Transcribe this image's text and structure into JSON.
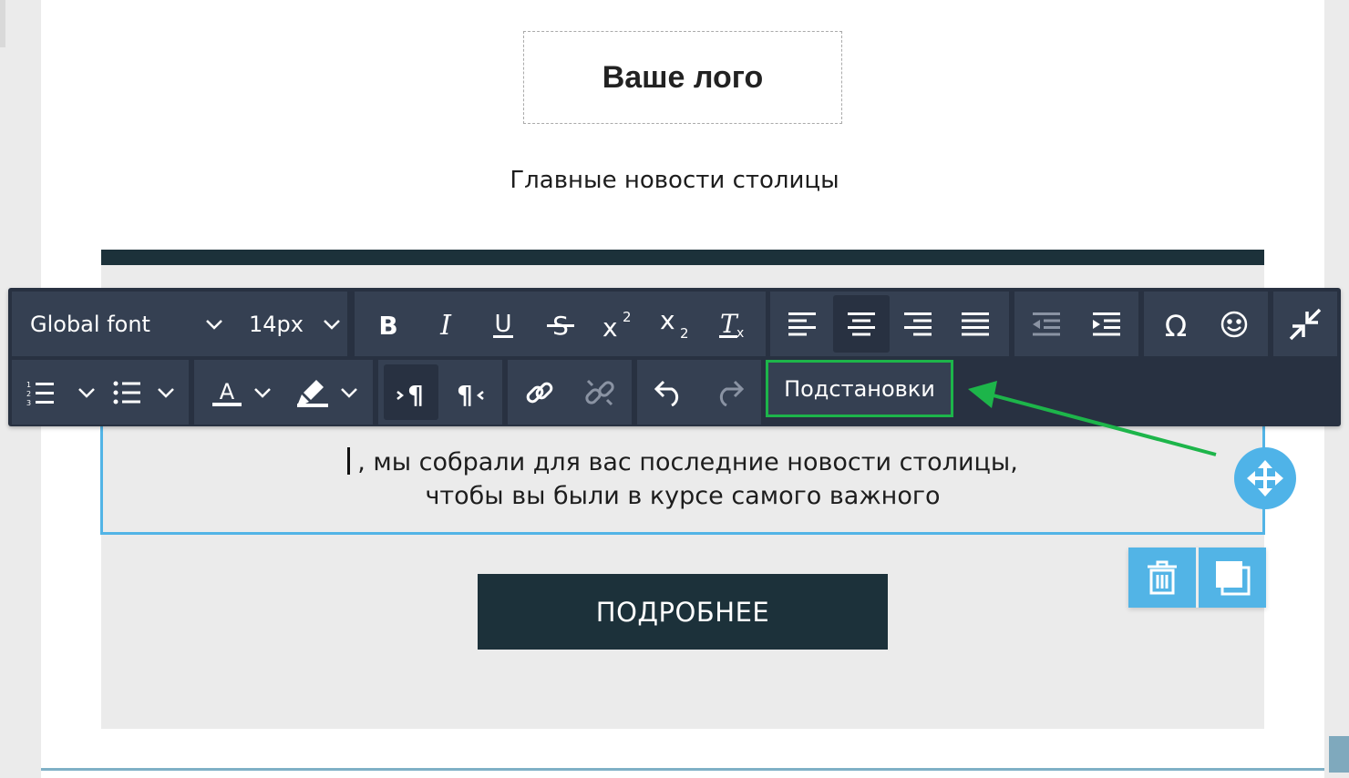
{
  "email": {
    "logo_text": "Ваше лого",
    "headline": "Главные новости столицы",
    "body_line1": ", мы собрали для вас последние новости столицы,",
    "body_line2": "чтобы вы были в курсе самого важного",
    "button_label": "ПОДРОБНЕЕ"
  },
  "toolbar": {
    "font_family": "Global font",
    "font_size": "14px",
    "substitutions_label": "Подстановки",
    "icons": [
      "bold-icon",
      "italic-icon",
      "underline-icon",
      "strikethrough-icon",
      "superscript-icon",
      "subscript-icon",
      "clear-format-icon",
      "align-left-icon",
      "align-center-icon",
      "align-right-icon",
      "align-justify-icon",
      "outdent-icon",
      "indent-icon",
      "special-char-icon",
      "emoji-icon",
      "collapse-icon",
      "ordered-list-icon",
      "unordered-list-icon",
      "text-color-icon",
      "highlight-icon",
      "ltr-icon",
      "rtl-icon",
      "link-icon",
      "unlink-icon",
      "undo-icon",
      "redo-icon"
    ]
  },
  "block_controls": {
    "icons": [
      "move-icon",
      "trash-icon",
      "duplicate-icon"
    ]
  },
  "colors": {
    "toolbar_bg": "#283141",
    "toolbar_group": "#354052",
    "accent_blue": "#52b4e6",
    "highlight_green": "#1db54a",
    "dark_block": "#1c313a"
  }
}
